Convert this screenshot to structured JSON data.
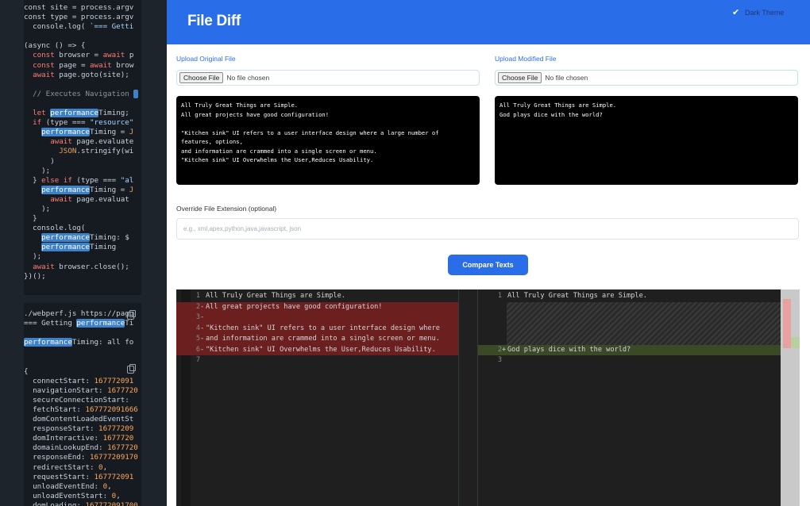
{
  "code_panel": {
    "block1": [
      [
        {
          "t": "const site = process.argv"
        }
      ],
      [
        {
          "t": "const type = process.argv"
        }
      ],
      [
        {
          "t": "  console.log( "
        },
        {
          "t": "`=== Getti",
          "c": "st"
        }
      ],
      [
        {
          "t": ""
        }
      ],
      [
        {
          "t": "(async () => {"
        }
      ],
      [
        {
          "t": "  "
        },
        {
          "t": "const",
          "c": "kw"
        },
        {
          "t": " browser = "
        },
        {
          "t": "await",
          "c": "kw"
        },
        {
          "t": " p"
        }
      ],
      [
        {
          "t": "  "
        },
        {
          "t": "const",
          "c": "kw"
        },
        {
          "t": " page = "
        },
        {
          "t": "await",
          "c": "kw"
        },
        {
          "t": " brow"
        }
      ],
      [
        {
          "t": "  "
        },
        {
          "t": "await",
          "c": "kw"
        },
        {
          "t": " page.goto(site);"
        }
      ],
      [
        {
          "t": ""
        }
      ],
      [
        {
          "t": "  // Executes Navigation ",
          "c": "cm"
        },
        {
          "t": " ",
          "c": "hl"
        }
      ],
      [
        {
          "t": ""
        }
      ],
      [
        {
          "t": "  "
        },
        {
          "t": "let",
          "c": "kw"
        },
        {
          "t": " "
        },
        {
          "t": "performance",
          "c": "hl"
        },
        {
          "t": "Timing;"
        }
      ],
      [
        {
          "t": "  "
        },
        {
          "t": "if",
          "c": "kw"
        },
        {
          "t": " (type === "
        },
        {
          "t": "\"resource\"",
          "c": "st"
        }
      ],
      [
        {
          "t": "    "
        },
        {
          "t": "performance",
          "c": "hl"
        },
        {
          "t": "Timing = "
        },
        {
          "t": "J",
          "c": "or"
        }
      ],
      [
        {
          "t": "      "
        },
        {
          "t": "await",
          "c": "kw"
        },
        {
          "t": " page.evaluate"
        }
      ],
      [
        {
          "t": "        "
        },
        {
          "t": "JSON",
          "c": "or"
        },
        {
          "t": ".stringify(wi"
        }
      ],
      [
        {
          "t": "      )"
        }
      ],
      [
        {
          "t": "    );"
        }
      ],
      [
        {
          "t": "  } "
        },
        {
          "t": "else if",
          "c": "kw"
        },
        {
          "t": " (type === "
        },
        {
          "t": "\"al",
          "c": "st"
        }
      ],
      [
        {
          "t": "    "
        },
        {
          "t": "performance",
          "c": "hl"
        },
        {
          "t": "Timing = "
        },
        {
          "t": "J",
          "c": "or"
        }
      ],
      [
        {
          "t": "      "
        },
        {
          "t": "await",
          "c": "kw"
        },
        {
          "t": " page.evaluat"
        }
      ],
      [
        {
          "t": "    );"
        }
      ],
      [
        {
          "t": "  }"
        }
      ],
      [
        {
          "t": "  console.log("
        }
      ],
      [
        {
          "t": "    "
        },
        {
          "t": "performance",
          "c": "hl"
        },
        {
          "t": "Timing: $"
        }
      ],
      [
        {
          "t": "    "
        },
        {
          "t": "performance",
          "c": "hl"
        },
        {
          "t": "Timing"
        }
      ],
      [
        {
          "t": "  );"
        }
      ],
      [
        {
          "t": "  "
        },
        {
          "t": "await",
          "c": "kw"
        },
        {
          "t": " browser.close();"
        }
      ],
      [
        {
          "t": "})();"
        }
      ]
    ],
    "block2": [
      [
        {
          "t": "./webperf.js https://pagg"
        }
      ],
      [
        {
          "t": "=== Getting "
        },
        {
          "t": "performance",
          "c": "hl"
        },
        {
          "t": "Ti"
        }
      ],
      [
        {
          "t": ""
        }
      ],
      [
        {
          "t": "performance",
          "c": "hl"
        },
        {
          "t": "Timing: all fo"
        }
      ],
      [
        {
          "t": ""
        }
      ],
      [
        {
          "t": ""
        }
      ],
      [
        {
          "t": "{"
        }
      ],
      [
        {
          "t": "  connectStart: "
        },
        {
          "t": "167772091",
          "c": "nm"
        }
      ],
      [
        {
          "t": "  navigationStart: "
        },
        {
          "t": "1677720",
          "c": "nm"
        }
      ],
      [
        {
          "t": "  secureConnectionStart: "
        }
      ],
      [
        {
          "t": "  fetchStart: "
        },
        {
          "t": "167772091666",
          "c": "nm"
        }
      ],
      [
        {
          "t": "  domContentLoadedEventSt"
        }
      ],
      [
        {
          "t": "  responseStart: "
        },
        {
          "t": "16777209",
          "c": "nm"
        }
      ],
      [
        {
          "t": "  domInteractive: "
        },
        {
          "t": "1677720",
          "c": "nm"
        }
      ],
      [
        {
          "t": "  domainLookupEnd: "
        },
        {
          "t": "1677720",
          "c": "nm"
        }
      ],
      [
        {
          "t": "  responseEnd: "
        },
        {
          "t": "16777209170",
          "c": "nm"
        }
      ],
      [
        {
          "t": "  redirectStart: "
        },
        {
          "t": "0",
          "c": "nm"
        },
        {
          "t": ","
        }
      ],
      [
        {
          "t": "  requestStart: "
        },
        {
          "t": "167772091",
          "c": "nm"
        }
      ],
      [
        {
          "t": "  unloadEventEnd: "
        },
        {
          "t": "0",
          "c": "nm"
        },
        {
          "t": ","
        }
      ],
      [
        {
          "t": "  unloadEventStart: "
        },
        {
          "t": "0",
          "c": "nm"
        },
        {
          "t": ","
        }
      ],
      [
        {
          "t": "  domLoading: "
        },
        {
          "t": "167772091700",
          "c": "nm"
        }
      ]
    ]
  },
  "header": {
    "title": "File Diff",
    "dark_theme_label": "Dark Theme",
    "dark_theme_checked": true
  },
  "upload": {
    "original_label": "Upload Original File",
    "modified_label": "Upload Modified File",
    "choose_button": "Choose File",
    "no_file": "No file chosen"
  },
  "original_text": "All Truly Great Things are Simple.\nAll great projects have good configuration!\n\n\"Kitchen sink\" UI refers to a user interface design where a large number of\nfeatures, options,\nand information are crammed into a single screen or menu.\n\"Kitchen sink\" UI Overwhelms the User,Reduces Usability.",
  "modified_text": "All Truly Great Things are Simple.\nGod plays dice with the world?",
  "extension": {
    "label": "Override File Extension (optional)",
    "placeholder": "e.g., xml,apex,python,java,javascript, json"
  },
  "compare_button": "Compare Texts",
  "diff": {
    "left": [
      {
        "n": "1",
        "s": " ",
        "t": "All Truly Great Things are Simple.",
        "type": "same"
      },
      {
        "n": "2",
        "s": "-",
        "t": "All great projects have good configuration!",
        "type": "removed"
      },
      {
        "n": "3",
        "s": "-",
        "t": "",
        "type": "removed"
      },
      {
        "n": "4",
        "s": "-",
        "t": "\"Kitchen sink\" UI refers to a user interface design where",
        "type": "removed"
      },
      {
        "n": "5",
        "s": "-",
        "t": "and information are crammed into a single screen or menu.",
        "type": "removed"
      },
      {
        "n": "6",
        "s": "-",
        "t": "\"Kitchen sink\" UI Overwhelms the User,Reduces Usability.",
        "type": "removed"
      },
      {
        "n": "7",
        "s": " ",
        "t": "",
        "type": "same"
      }
    ],
    "right": [
      {
        "n": "1",
        "s": " ",
        "t": "All Truly Great Things are Simple.",
        "type": "same"
      },
      {
        "n": "",
        "s": "",
        "t": "",
        "type": "gap"
      },
      {
        "n": "",
        "s": "",
        "t": "",
        "type": "gap"
      },
      {
        "n": "",
        "s": "",
        "t": "",
        "type": "gap"
      },
      {
        "n": "",
        "s": "",
        "t": "",
        "type": "gap"
      },
      {
        "n": "2",
        "s": "+",
        "t": "God plays dice with the world?",
        "type": "added"
      },
      {
        "n": "3",
        "s": " ",
        "t": "",
        "type": "same"
      }
    ]
  }
}
